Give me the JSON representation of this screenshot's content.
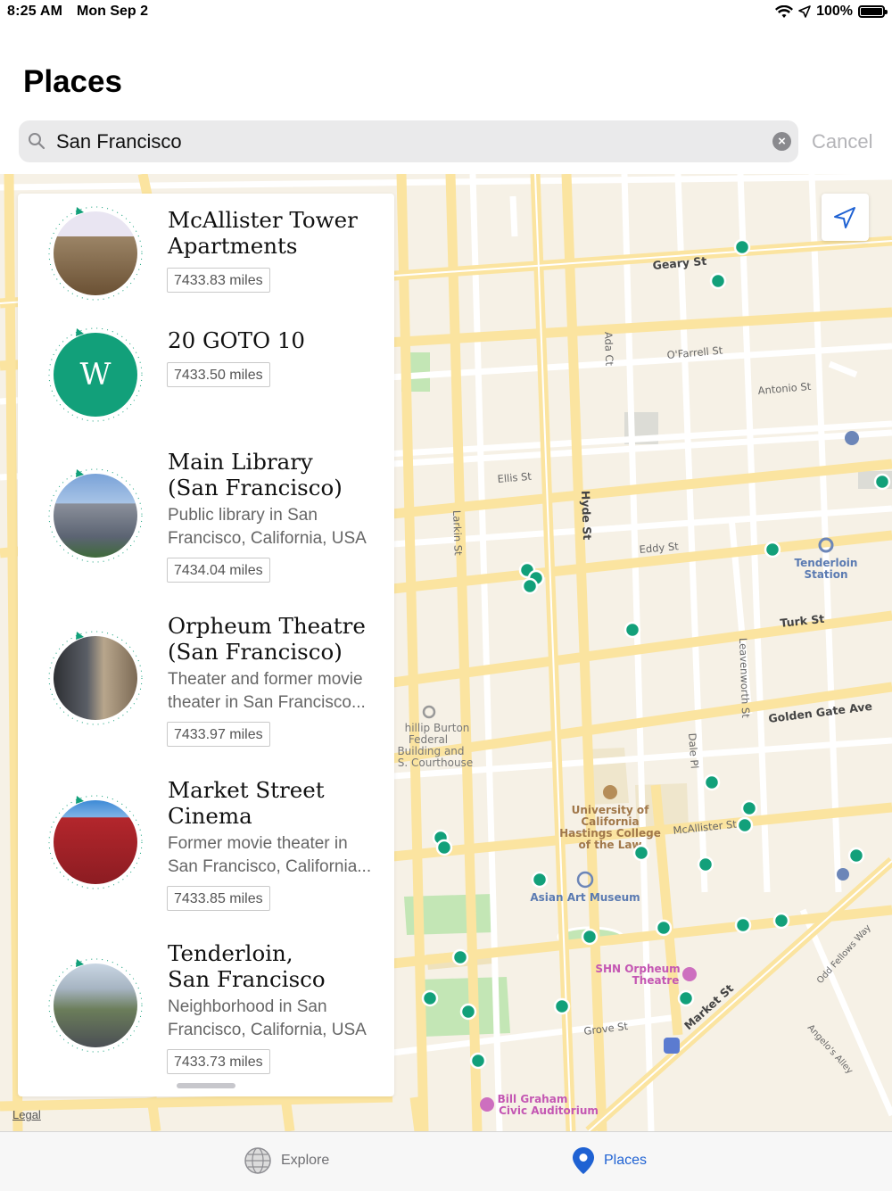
{
  "status_bar": {
    "time": "8:25 AM",
    "date": "Mon Sep 2",
    "battery": "100%"
  },
  "header": {
    "title": "Places"
  },
  "search": {
    "value": "San Francisco",
    "cancel_label": "Cancel"
  },
  "colors": {
    "accent": "#1f62d3",
    "marker": "#12a07a",
    "road": "#fbe4a0",
    "park": "#c3e6b5"
  },
  "places": [
    {
      "title": "McAllister Tower\nApartments",
      "description": "",
      "distance": "7433.83 miles",
      "thumb": "building-photo"
    },
    {
      "title": "20 GOTO 10",
      "description": "",
      "distance": "7433.50 miles",
      "thumb": "wikipedia-logo"
    },
    {
      "title": "Main Library\n(San Francisco)",
      "description": "Public library in San\nFrancisco, California, USA",
      "distance": "7434.04 miles",
      "thumb": "library-photo"
    },
    {
      "title": "Orpheum Theatre\n(San Francisco)",
      "description": "Theater and former movie\ntheater in San Francisco...",
      "distance": "7433.97 miles",
      "thumb": "theatre-photo"
    },
    {
      "title": "Market Street\nCinema",
      "description": "Former movie theater in\nSan Francisco, California...",
      "distance": "7433.85 miles",
      "thumb": "cinema-photo"
    },
    {
      "title": "Tenderloin,\nSan Francisco",
      "description": "Neighborhood in San\nFrancisco, California, USA",
      "distance": "7433.73 miles",
      "thumb": "street-photo"
    }
  ],
  "map": {
    "streets": [
      "Geary St",
      "O'Farrell St",
      "Antonio St",
      "Ellis St",
      "Eddy St",
      "Turk St",
      "Golden Gate Ave",
      "McAllister St",
      "Grove St",
      "Market St",
      "Hyde St",
      "Larkin St",
      "Leavenworth St",
      "Dale Pl",
      "Ada Ct",
      "Odd Fellows Way",
      "Angelo's Alley"
    ],
    "poi": [
      "Tenderloin\nStation",
      "University of\nCalifornia\nHastings College\nof the Law",
      "Asian Art Museum",
      "SHN Orpheum\nTheatre",
      "Bill Graham\nCivic Auditorium",
      "hillip Burton\nFederal\nBuilding and\nS. Courthouse"
    ],
    "legal": "Legal"
  },
  "tabs": [
    {
      "label": "Explore",
      "icon": "globe-icon"
    },
    {
      "label": "Places",
      "icon": "map-pin-icon"
    }
  ]
}
